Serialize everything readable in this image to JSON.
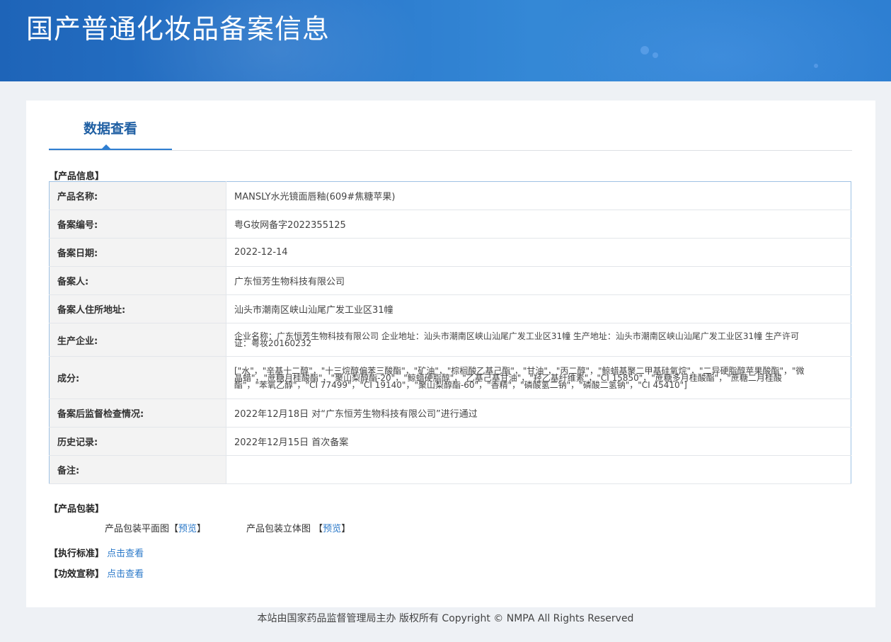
{
  "header": {
    "title": "国产普通化妆品备案信息"
  },
  "tabs": [
    {
      "label": "数据查看"
    }
  ],
  "product_info": {
    "section_title": "【产品信息】",
    "rows": [
      {
        "label": "产品名称:",
        "value": "MANSLY水光镜面唇釉(609#焦糖苹果)"
      },
      {
        "label": "备案编号:",
        "value": "粤G妆网备字2022355125"
      },
      {
        "label": "备案日期:",
        "value": "2022-12-14"
      },
      {
        "label": "备案人:",
        "value": "广东恒芳生物科技有限公司"
      },
      {
        "label": "备案人住所地址:",
        "value": "汕头市潮南区峡山汕尾广发工业区31幢"
      },
      {
        "label": "生产企业:",
        "value": "企业名称：广东恒芳生物科技有限公司 企业地址：汕头市潮南区峡山汕尾广发工业区31幢 生产地址：汕头市潮南区峡山汕尾广发工业区31幢 生产许可证：粤妆20160232"
      },
      {
        "label": "成分:",
        "value": "[\"水\"，\"辛基十二醇\"，\"十三烷醇偏苯三酸酯\"，\"矿油\"，\"棕榈酸乙基己酯\"，\"甘油\"，\"丙二醇\"，\"鲸蜡基聚二甲基硅氧烷\"，\"二异硬脂醇苹果酸酯\"，\"微晶蜡\"，\"蔗糖月桂酸酯\"，\"聚山梨醇酯-20\"，\"鲸蜡硬脂醇\"，\"乙基己基甘油\"，\"羟乙基纤维素\"，\"CI 15850\"，\"蔗糖多月桂酸酯\"，\"蔗糖二月桂酸酯\"，\"苯氧乙醇\"，\"CI 77499\"，\"CI 19140\"，\"聚山梨醇酯-60\"，\"香精\"，\"磷酸氢二钠\"，\"磷酸二氢钠\"，\"CI 45410\"]"
      },
      {
        "label": "备案后监督检查情况:",
        "value": "2022年12月18日 对“广东恒芳生物科技有限公司”进行通过"
      },
      {
        "label": "历史记录:",
        "value": "2022年12月15日 首次备案"
      },
      {
        "label": "备注:",
        "value": ""
      }
    ]
  },
  "packaging": {
    "section_title": "【产品包装】",
    "flat_label": "产品包装平面图",
    "flat_link": "预览",
    "solid_label": "产品包装立体图",
    "solid_link": "预览",
    "bracket_open": "【",
    "bracket_close": "】"
  },
  "standard": {
    "label": "【执行标准】",
    "link": "点击查看"
  },
  "efficacy": {
    "label": "【功效宣称】",
    "link": "点击查看"
  },
  "footer": {
    "text": "本站由国家药品监督管理局主办 版权所有 Copyright © NMPA All Rights Reserved"
  },
  "colors": {
    "banner": "#2a78cc",
    "accent": "#2f7ed1",
    "link": "#2b79c9",
    "tab_text": "#1f5fa3"
  }
}
